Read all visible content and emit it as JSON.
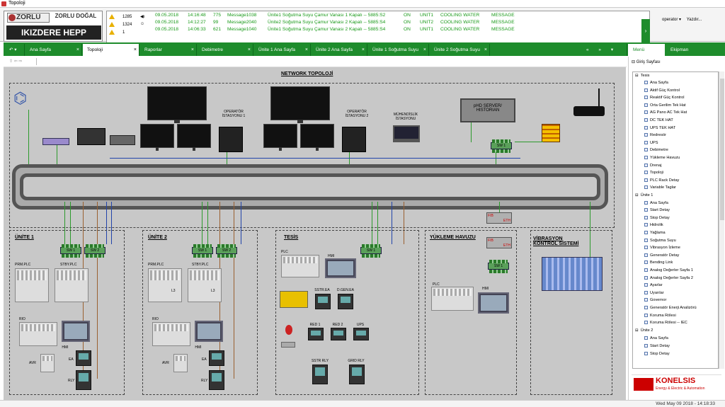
{
  "window": {
    "title": "Topoloji"
  },
  "header": {
    "logo": {
      "brand": "ZORLU",
      "brand2": "ZORLU DOĞAL",
      "plant": "IKIZDERE HEPP"
    },
    "counts": [
      {
        "value": "1285",
        "icon": "warning-icon"
      },
      {
        "value": "1324",
        "icon": "warning-icon"
      },
      {
        "value": "1",
        "icon": "warning-icon"
      }
    ],
    "alarms": [
      {
        "date": "09.05.2018",
        "time": "14:16:48",
        "id": "775",
        "msg": "Message1038",
        "desc": "Ünite1 Soğutma Suyu Çamur Vanası 1 Kapalı -- 5885:S2",
        "state": "ON",
        "unit": "UNIT1",
        "sys": "COOLING WATER",
        "type": "MESSAGE"
      },
      {
        "date": "09.05.2018",
        "time": "14:12:27",
        "id": "99",
        "msg": "Message2040",
        "desc": "Ünite2 Soğutma Suyu Çamur Vanası 2 Kapalı -- 5885:S4",
        "state": "ON",
        "unit": "UNIT2",
        "sys": "COOLING WATER",
        "type": "MESSAGE"
      },
      {
        "date": "09.05.2018",
        "time": "14:06:33",
        "id": "621",
        "msg": "Message1040",
        "desc": "Ünite1 Soğutma Suyu Çamur Vanası 2 Kapalı -- 5885:S4",
        "state": "ON",
        "unit": "UNIT1",
        "sys": "COOLING WATER",
        "type": "MESSAGE"
      }
    ],
    "user": "operator",
    "print": "Yazdır..."
  },
  "tabs": [
    "Ana Sayfa",
    "Topoloji",
    "Raporlar",
    "Debimetre",
    "Ünite 1 Ana Sayfa",
    "Ünite 2 Ana Sayfa",
    "Ünite 1 Soğutma Suyu",
    "Ünite 2 Soğutma Suyu"
  ],
  "active_tab": "Topoloji",
  "side_tabs": {
    "menu": "Menü",
    "ekipman": "Ekipman"
  },
  "diagram": {
    "title": "NETWORK TOPOLOJİ",
    "op1": "OPERATÖR İSTASYONU 1",
    "op2": "OPERATÖR İSTASYONU 2",
    "eng": "MÜHENDİSLİK İSTASYONU",
    "server": "pHD SERVER/ HISTORIAN",
    "sections": [
      "ÜNİTE 1",
      "ÜNİTE 2",
      "TESİS",
      "YÜKLEME HAVUZU",
      "VİBRASYON KONTROL SİSTEMİ"
    ],
    "sw1": "SW 1",
    "sw2": "SW 2",
    "plc": "PLC",
    "prm_plc": "PRM.PLC",
    "stby_plc": "STBY.PLC",
    "rio": "RIO",
    "hmi": "HMI",
    "avr": "AVR",
    "ea": "EA",
    "rly": "RLY",
    "l3": "L3",
    "sstr_ea": "SSTR.EA",
    "dgen_ea": "D.GEN.EA",
    "red1": "RED 1",
    "red2": "RED 2",
    "ups": "UPS",
    "sstr_rly": "SSTR RLY",
    "grid_rly": "GRID RLY",
    "fib": "FIB",
    "eth": "ETH"
  },
  "menu": {
    "header": "Giriş Sayfası",
    "groups": [
      {
        "name": "Tesis",
        "items": [
          "Ana Sayfa",
          "Aktif Güç Kontrol",
          "Reaktif Güç Kontrol",
          "Orta Gerilim Tek Hat",
          "AG Pano AC Tek Hat",
          "DC TEK HAT",
          "UPS TEK HAT",
          "Redresör",
          "UPS",
          "Debimetre",
          "Yükleme Havuzu",
          "Drenaj",
          "Topoloji",
          "PLC Rack Detay",
          "Variable Taglar"
        ]
      },
      {
        "name": "Ünite 1",
        "items": [
          "Ana Sayfa",
          "Start Detay",
          "Stop Detay",
          "Hidrolik",
          "Yağlama",
          "Soğutma Suyu",
          "Vibrasyon İzleme",
          "Generatör Detay",
          "Bending Link",
          "Analog Değerler Sayfa 1",
          "Analog Değerler Sayfa 2",
          "Ayarlar",
          "Uyarılar",
          "Governor",
          "Generatör Enerji Analizörü",
          "Koruma Rölesi",
          "Koruma Rölesi -- IEC"
        ]
      },
      {
        "name": "Ünite 2",
        "items": [
          "Ana Sayfa",
          "Start Detay",
          "Stop Detay"
        ]
      }
    ]
  },
  "brand": {
    "name": "KONELSIS",
    "tagline": "Energy & Electric & Automation"
  },
  "status": {
    "datetime": "Wed May 09 2018 - 14:18:33"
  }
}
